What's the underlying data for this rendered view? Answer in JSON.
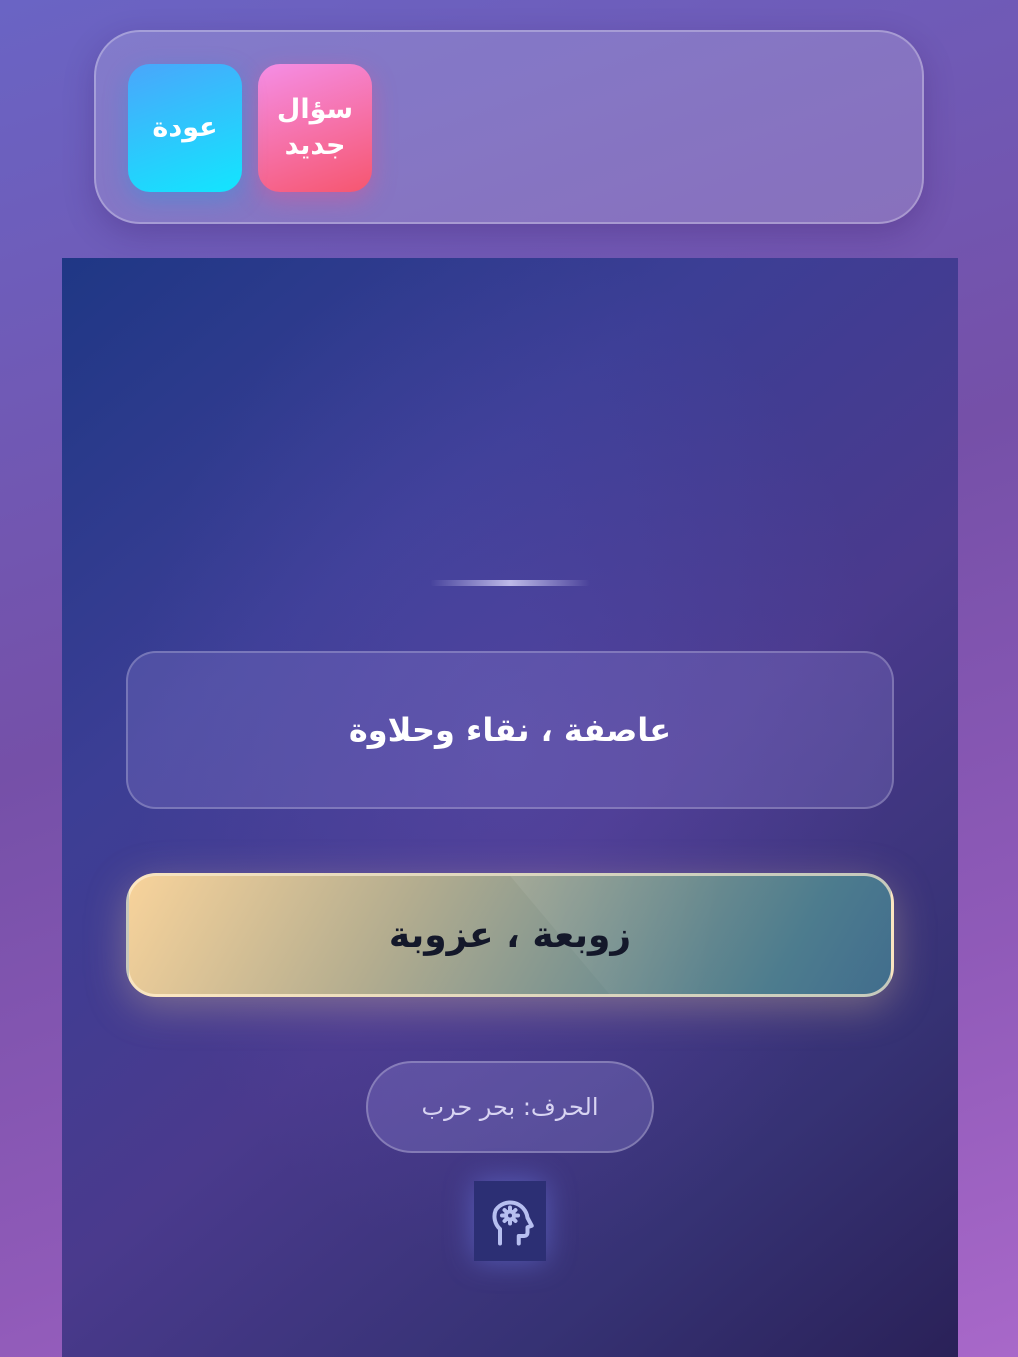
{
  "toolbar": {
    "back_label": "عودة",
    "new_question_line1": "سؤال",
    "new_question_line2": "جديد"
  },
  "card": {
    "clue": "عاصفة ، نقاء وحلاوة",
    "answer": "زوبعة ، عزوبة",
    "letter_hint": "الحرف: بحر حرب"
  },
  "icons": {
    "mind": "head-gear-icon"
  },
  "colors": {
    "back_button": "#12e6fe",
    "new_button": "#f6566f",
    "answer_highlight": "#f8d39b"
  }
}
